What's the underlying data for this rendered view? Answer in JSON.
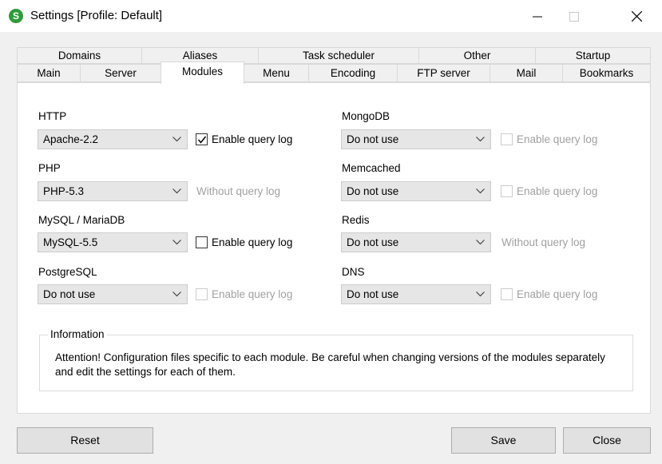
{
  "window": {
    "title": "Settings [Profile: Default]",
    "icon_letter": "S",
    "icon_color": "#2e9b3a"
  },
  "tabs": {
    "row1": [
      "Domains",
      "Aliases",
      "Task scheduler",
      "Other",
      "Startup"
    ],
    "row2": [
      "Main",
      "Server",
      "Modules",
      "Menu",
      "Encoding",
      "FTP server",
      "Mail",
      "Bookmarks"
    ],
    "active": "Modules"
  },
  "modules": {
    "http": {
      "label": "HTTP",
      "value": "Apache-2.2",
      "query_log": "Enable query log",
      "checked": true,
      "enabled": true
    },
    "php": {
      "label": "PHP",
      "value": "PHP-5.3",
      "no_log": "Without query log"
    },
    "mysql": {
      "label": "MySQL / MariaDB",
      "value": "MySQL-5.5",
      "query_log": "Enable query log",
      "checked": false,
      "enabled": true
    },
    "postgresql": {
      "label": "PostgreSQL",
      "value": "Do not use",
      "query_log": "Enable query log",
      "checked": false,
      "enabled": false
    },
    "mongodb": {
      "label": "MongoDB",
      "value": "Do not use",
      "query_log": "Enable query log",
      "checked": false,
      "enabled": false
    },
    "memcached": {
      "label": "Memcached",
      "value": "Do not use",
      "query_log": "Enable query log",
      "checked": false,
      "enabled": false
    },
    "redis": {
      "label": "Redis",
      "value": "Do not use",
      "no_log": "Without query log"
    },
    "dns": {
      "label": "DNS",
      "value": "Do not use",
      "query_log": "Enable query log",
      "checked": false,
      "enabled": false
    }
  },
  "information": {
    "title": "Information",
    "text": "Attention! Configuration files specific to each module. Be careful when changing versions of the modules separately and edit the settings for each of them."
  },
  "buttons": {
    "reset": "Reset",
    "save": "Save",
    "close": "Close"
  },
  "icons": {
    "minimize": "minimize-icon",
    "maximize": "maximize-icon",
    "close": "close-icon",
    "dropdown": "chevron-down-icon",
    "check": "checkmark-icon"
  }
}
